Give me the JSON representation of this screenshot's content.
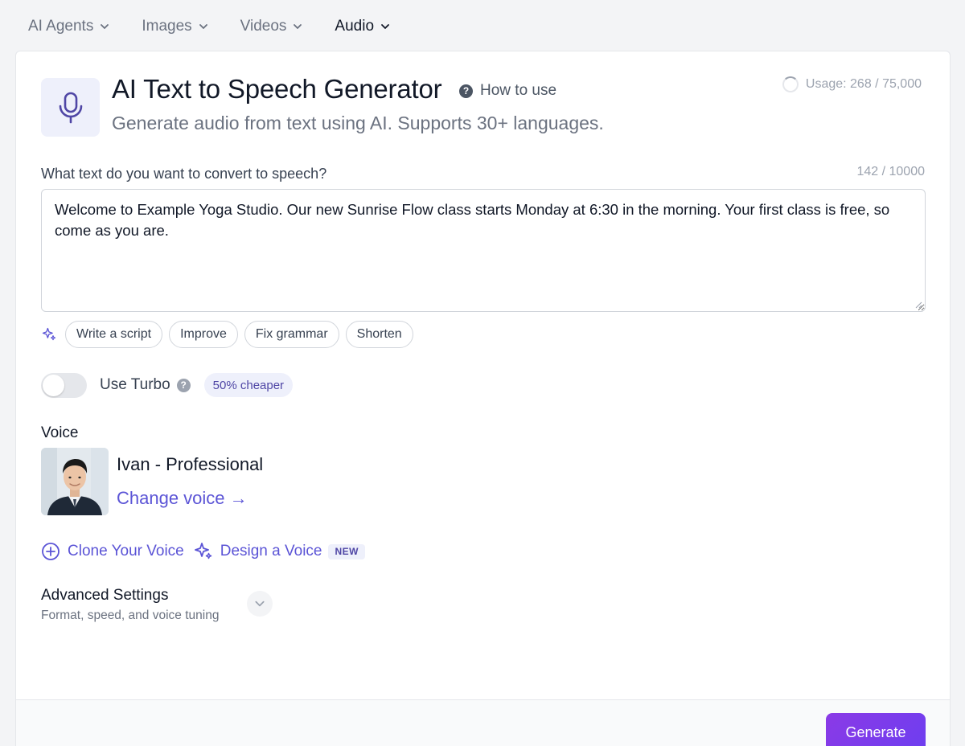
{
  "nav": {
    "items": [
      {
        "label": "AI Agents",
        "active": false
      },
      {
        "label": "Images",
        "active": false
      },
      {
        "label": "Videos",
        "active": false
      },
      {
        "label": "Audio",
        "active": true
      }
    ]
  },
  "header": {
    "icon": "microphone-icon",
    "title": "AI Text to Speech Generator",
    "how_to_use": "How to use",
    "subtitle": "Generate audio from text using AI. Supports 30+ languages.",
    "usage": "Usage: 268 / 75,000"
  },
  "text_input": {
    "label": "What text do you want to convert to speech?",
    "char_count": "142 / 10000",
    "value": "Welcome to Example Yoga Studio. Our new Sunrise Flow class starts Monday at 6:30 in the morning. Your first class is free, so come as you are."
  },
  "ai_actions": [
    "Write a script",
    "Improve",
    "Fix grammar",
    "Shorten"
  ],
  "turbo": {
    "label": "Use Turbo",
    "enabled": false,
    "badge": "50% cheaper"
  },
  "voice": {
    "label": "Voice",
    "name": "Ivan - Professional",
    "change_label": "Change voice →",
    "clone_label": "Clone Your Voice",
    "design_label": "Design a Voice",
    "new_badge": "NEW"
  },
  "advanced": {
    "title": "Advanced Settings",
    "subtitle": "Format, speed, and voice tuning"
  },
  "footer": {
    "generate_label": "Generate"
  },
  "colors": {
    "accent": "#5b54d6",
    "generate_gradient_start": "#8b3ae6",
    "generate_gradient_end": "#6d3ef0"
  }
}
